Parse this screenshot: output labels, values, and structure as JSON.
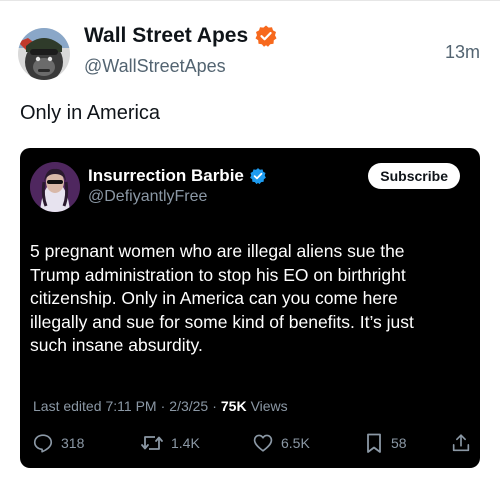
{
  "post": {
    "author_name": "Wall Street Apes",
    "author_handle": "@WallStreetApes",
    "time": "13m",
    "text": "Only in America"
  },
  "quoted": {
    "author_name": "Insurrection Barbie",
    "author_handle": "@DefiyantlyFree",
    "subscribe_label": "Subscribe",
    "text_lines": [
      "5 pregnant women who are illegal aliens sue the",
      "Trump administration to stop his EO on birthright",
      "citizenship. Only in America can you come here",
      "illegally and sue for some kind of benefits. It’s just",
      "such insane absurdity."
    ],
    "edited_label": "Last edited",
    "edited_time": "7:11 PM",
    "separator": "·",
    "edited_date": "2/3/25",
    "views_count": "75K",
    "views_label": "Views",
    "replies": "318",
    "reposts": "1.4K",
    "likes": "6.5K",
    "bookmarks": "58"
  },
  "colors": {
    "verified_orange": "#f7691d",
    "verified_blue": "#1d9bf0",
    "card_bg": "#000000",
    "secondary_text": "#8b98a5"
  },
  "icons": [
    "verified-badge-icon",
    "reply-icon",
    "repost-icon",
    "like-icon",
    "bookmark-icon",
    "share-icon"
  ]
}
